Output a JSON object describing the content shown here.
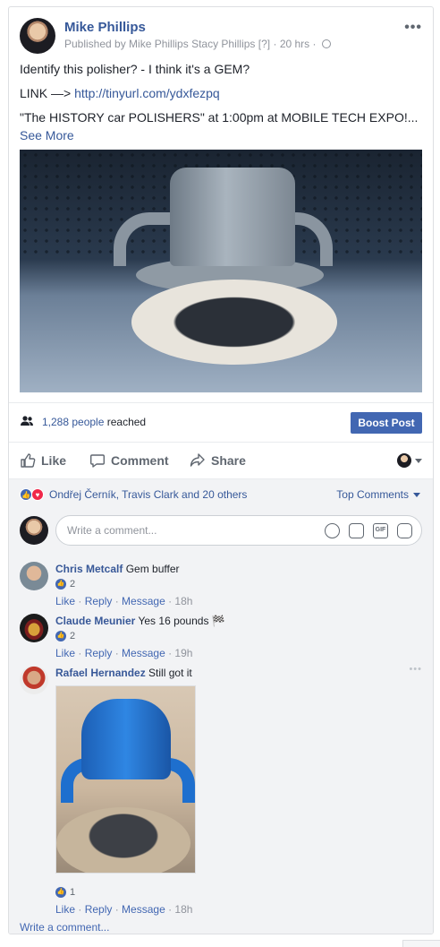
{
  "post": {
    "author": "Mike Phillips",
    "published_by": "Published by Mike Phillips Stacy Phillips",
    "help_mark": "[?]",
    "time": "20 hrs",
    "dot": "·",
    "line1": "Identify this polisher? - I think it's a GEM?",
    "link_prefix": "LINK —> ",
    "link_url": "http://tinyurl.com/ydxfezpq",
    "line3": "\"The HISTORY car POLISHERS\" at 1:00pm at MOBILE TECH EXPO!...",
    "see_more": "See More",
    "more_menu": "•••"
  },
  "reach": {
    "count": "1,288 people",
    "suffix": " reached",
    "boost_label": "Boost Post"
  },
  "actions": {
    "like": "Like",
    "comment": "Comment",
    "share": "Share"
  },
  "comments_section": {
    "reactions_text": "Ondřej Černík, Travis Clark and 20 others",
    "top_comments": "Top Comments",
    "write_placeholder": "Write a comment...",
    "gif_label": "GIF",
    "write_bottom": "Write a comment..."
  },
  "comments": [
    {
      "name": "Chris Metcalf",
      "text": "Gem buffer",
      "likes": "2",
      "like_label": "Like",
      "reply_label": "Reply",
      "message_label": "Message",
      "time": "18h",
      "sep": " · "
    },
    {
      "name": "Claude Meunier",
      "text": "Yes 16 pounds 🏁",
      "likes": "2",
      "like_label": "Like",
      "reply_label": "Reply",
      "message_label": "Message",
      "time": "19h",
      "sep": " · "
    },
    {
      "name": "Rafael Hernandez",
      "text": "Still got it",
      "likes": "1",
      "like_label": "Like",
      "reply_label": "Reply",
      "message_label": "Message",
      "time": "18h",
      "sep": " · "
    }
  ],
  "colors": {
    "link": "#365899",
    "boost": "#4267b2",
    "background_comments": "#f2f3f5"
  },
  "icons": [
    "globe-icon",
    "people-icon",
    "like-icon",
    "comment-icon",
    "share-icon",
    "emoji-icon",
    "camera-icon",
    "gif-icon",
    "sticker-icon",
    "more-icon"
  ]
}
